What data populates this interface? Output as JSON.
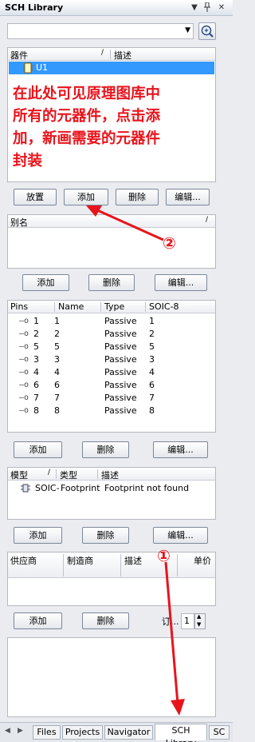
{
  "window": {
    "title": "SCH Library",
    "dropdown_icon": "▼",
    "pin_icon": "𝟰",
    "close_icon": "✕"
  },
  "search": {
    "value": ""
  },
  "components": {
    "col_component": "器件",
    "col_description": "描述",
    "items": [
      {
        "name": "U1"
      }
    ],
    "buttons": {
      "place": "放置",
      "add": "添加",
      "delete": "删除",
      "edit": "编辑..."
    }
  },
  "annotation": {
    "lines": [
      "在此处可见原理图库中",
      "所有的元器件，点击添",
      "加，新画需要的元器件",
      "封装"
    ],
    "marker_two": "②",
    "marker_one": "①"
  },
  "aliases": {
    "col_alias": "别名",
    "buttons": {
      "add": "添加",
      "delete": "删除",
      "edit": "编辑..."
    }
  },
  "pins": {
    "columns": [
      "Pins",
      "Name",
      "Type",
      "SOIC-8"
    ],
    "rows": [
      {
        "pin": "1",
        "name": "1",
        "type": "Passive",
        "soic": "1"
      },
      {
        "pin": "2",
        "name": "2",
        "type": "Passive",
        "soic": "2"
      },
      {
        "pin": "5",
        "name": "5",
        "type": "Passive",
        "soic": "5"
      },
      {
        "pin": "3",
        "name": "3",
        "type": "Passive",
        "soic": "3"
      },
      {
        "pin": "4",
        "name": "4",
        "type": "Passive",
        "soic": "4"
      },
      {
        "pin": "6",
        "name": "6",
        "type": "Passive",
        "soic": "6"
      },
      {
        "pin": "7",
        "name": "7",
        "type": "Passive",
        "soic": "7"
      },
      {
        "pin": "8",
        "name": "8",
        "type": "Passive",
        "soic": "8"
      }
    ],
    "buttons": {
      "add": "添加",
      "delete": "删除",
      "edit": "编辑..."
    }
  },
  "models": {
    "columns": [
      "模型",
      "类型",
      "描述"
    ],
    "rows": [
      {
        "model": "SOIC-",
        "type": "Footprint",
        "desc": "Footprint not found"
      }
    ],
    "buttons": {
      "add": "添加",
      "delete": "删除",
      "edit": "编辑..."
    }
  },
  "suppliers": {
    "columns": [
      "供应商",
      "制造商",
      "描述",
      "单价"
    ],
    "buttons": {
      "add": "添加",
      "delete": "删除"
    },
    "order_label": "订...",
    "order_qty": "1"
  },
  "tabs": [
    "Files",
    "Projects",
    "Navigator",
    "SCH Library",
    "SC"
  ],
  "colors": {
    "annotation_red": "#e8141c",
    "selection_blue": "#3399ff"
  }
}
